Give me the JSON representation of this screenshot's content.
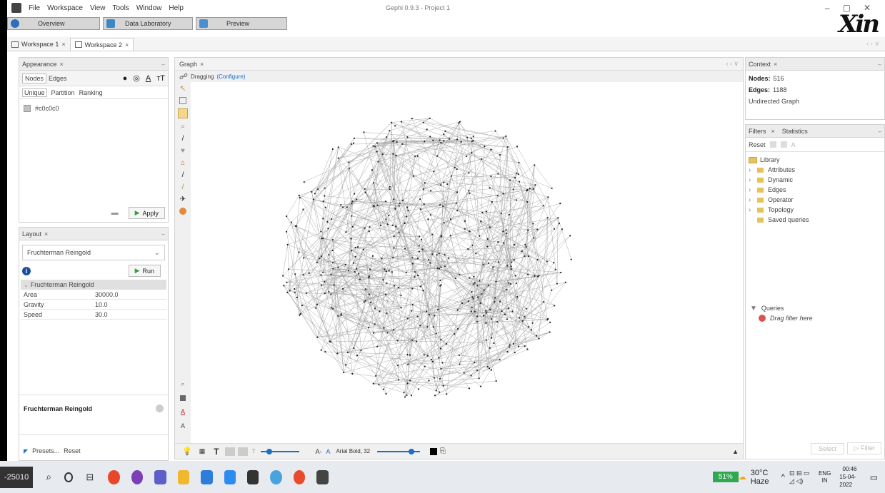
{
  "window": {
    "title": "Gephi 0.9.3 - Project 1",
    "menu": [
      "File",
      "Workspace",
      "View",
      "Tools",
      "Window",
      "Help"
    ],
    "controls": [
      "–",
      "▢",
      "✕"
    ],
    "brand_text": "Xin"
  },
  "big_tabs": [
    "Overview",
    "Data Laboratory",
    "Preview"
  ],
  "workspace_tabs": [
    {
      "label": "Workspace 1",
      "close": "×"
    },
    {
      "label": "Workspace 2",
      "close": "×"
    }
  ],
  "appearance": {
    "title": "Appearance",
    "close": "×",
    "element_tabs": [
      "Nodes",
      "Edges"
    ],
    "mode_tabs": [
      "Unique",
      "Partition",
      "Ranking"
    ],
    "color_value": "#c0c0c0",
    "apply_label": "Apply"
  },
  "layout": {
    "title": "Layout",
    "close": "×",
    "algorithm": "Fruchterman Reingold",
    "run_label": "Run",
    "section_label": "Fruchterman Reingold",
    "properties": [
      {
        "name": "Area",
        "value": "30000.0"
      },
      {
        "name": "Gravity",
        "value": "10.0"
      },
      {
        "name": "Speed",
        "value": "30.0"
      }
    ],
    "description_title": "Fruchterman Reingold",
    "presets_label": "Presets...",
    "reset_label": "Reset"
  },
  "graph": {
    "title": "Graph",
    "close": "×",
    "mode_label": "Dragging",
    "configure_label": "(Configure)",
    "font_label": "Arial Bold, 32"
  },
  "context": {
    "title": "Context",
    "close": "×",
    "nodes_label": "Nodes:",
    "nodes_value": "516",
    "edges_label": "Edges:",
    "edges_value": "1188",
    "graph_type": "Undirected Graph"
  },
  "filters": {
    "tabs": [
      "Filters",
      "Statistics"
    ],
    "close": "×",
    "reset_label": "Reset",
    "library": "Library",
    "items": [
      "Attributes",
      "Dynamic",
      "Edges",
      "Operator",
      "Topology",
      "Saved queries"
    ],
    "queries_label": "Queries",
    "drag_hint": "Drag filter here",
    "select_label": "Select",
    "filter_label": "Filter"
  },
  "taskbar": {
    "left_label": "-25010",
    "battery": "51%",
    "weather": "30°C Haze",
    "lang_top": "ENG",
    "lang_bottom": "IN",
    "time": "00:46",
    "date": "15-04-2022"
  },
  "colors": {
    "accent": "#1a6ec8",
    "apply_green": "#3b9c3b",
    "node": "#222222",
    "edge": "#9a9a9a"
  }
}
